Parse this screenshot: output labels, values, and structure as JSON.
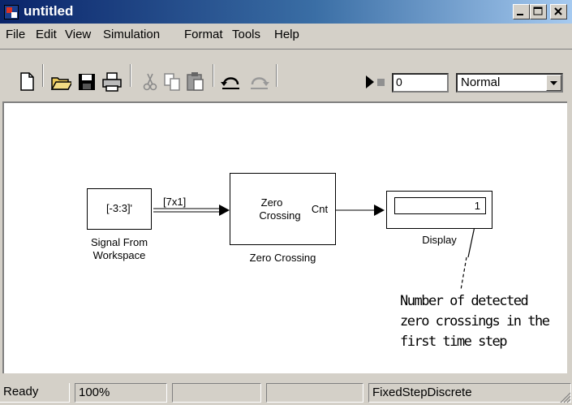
{
  "window": {
    "title": "untitled"
  },
  "menu": [
    "File",
    "Edit",
    "View",
    "Simulation",
    "Format",
    "Tools",
    "Help"
  ],
  "toolbar": {
    "icons": [
      "new-file-icon",
      "open-folder-icon",
      "save-icon",
      "print-icon",
      "cut-icon",
      "copy-icon",
      "paste-icon",
      "undo-icon",
      "redo-icon",
      "play-icon",
      "stop-icon"
    ],
    "stop_time": "0",
    "mode": "Normal"
  },
  "diagram": {
    "source_block": {
      "content": "[-3:3]'",
      "label_line1": "Signal From",
      "label_line2": "Workspace"
    },
    "signal_label": "[7x1]",
    "zc_block": {
      "text_line1": "Zero",
      "text_line2": "Crossing",
      "port": "Cnt",
      "label": "Zero Crossing"
    },
    "display_block": {
      "value": "1",
      "label": "Display"
    },
    "annotation": [
      "Number of detected",
      "zero crossings in the",
      "first time step"
    ]
  },
  "status": {
    "state": "Ready",
    "zoom": "100%",
    "cell3": "",
    "cell4": "",
    "solver": "FixedStepDiscrete"
  },
  "colors": {
    "titlebar_start": "#0a246a",
    "titlebar_end": "#a6caf0",
    "chrome": "#d4d0c8"
  }
}
